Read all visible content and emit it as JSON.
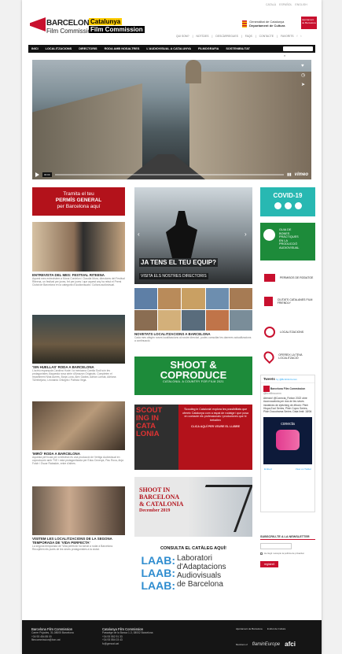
{
  "lang": [
    "CATALÀ",
    "ESPAÑOL",
    "ENGLISH"
  ],
  "logo": {
    "line1": "BARCELONA",
    "line2": "Film Commission",
    "cat": "Catalunya",
    "fc": "Film Commission"
  },
  "gencat": {
    "line1": "Generalitat de Catalunya",
    "line2": "Departament de Cultura"
  },
  "ajuntament": "Ajuntament de Barcelona",
  "topnav": [
    "QUI SOM?",
    "NOTÍCIES",
    "DESCÀRREGUES",
    "FAQS",
    "CONTACTE",
    "FAVORITS"
  ],
  "mainnav": [
    "INICI",
    "LOCALITZACIONS",
    "DIRECTORIS",
    "RODA AMB NOSALTRES",
    "L'AUDIOVISUAL A CATALUNYA",
    "FILMOGRAFIA",
    "SOSTENIBILITAT"
  ],
  "video": {
    "time": "00:00",
    "brand": "vimeo"
  },
  "col1": {
    "banner": [
      "Tramita el teu",
      "PERMÍS GENERAL",
      "per Barcelona aquí"
    ],
    "items": [
      {
        "title": "ENTREVISTA DEL MES: FESTIVAL RITEENA",
        "text": "Aquest mes entrevistem a Mona Cordelon i Claudia Mora, directores del Festival Riteena, un festival per joves, fet per joves i que aquest any ha rebut el Premi Ciutat de Barcelona en la categoria d'Audiovisuals i Cultura audiovisual."
      },
      {
        "title": "'SIN HUELLAS' RODA A BARCELONA",
        "text": "L'actriu espanyola Carolina Yuste i la mexicana Camila Sodi són les protagonistes d'aquesta nova sèrie d'Amazon Originals. Completen el repartiment Nina Aurres, Borja Luna, Alex Gadea, Adrian Lorista, Adriana Torrebejano, Leonardo Ortizgris i Patricia Vega."
      },
      {
        "title": "'MIRÓ' RODA A BARCELONA",
        "text": "Aquesta pel·lícula per a televisió és una producció de Vertigo Audiovisual en coproducció amb TVE i està protagonitzada per Eduu Doverya, Pau Roca, Anja Fotch i Óscar Rabadán, entre d'altres."
      },
      {
        "title": "VISITEM LES LOCALITZACIONS DE LA SEGONA TEMPORADA DE 'VIDA PERFECTA'",
        "text": "La segona temporada de 'Vida perfecta' ha tornat a rodar a Barcelona. Recopilem els punts de les seves protagonistes a la ciutat."
      }
    ]
  },
  "col2": {
    "slide_title": "JA TENS EL TEU EQUIP?",
    "slide_sub": "VISITA ELS NOSTRES DIRECTORIS",
    "news_title": "NOVETATS LOCALITZACIONS A BARCELONA",
    "news_text": "Cada mes afegim noves localitzacions al nostre directori, podeu consultar les darreres actualitzacions a continuació.",
    "shoot_a": "SHOOT &",
    "shoot_b": "COPRODUCE",
    "shoot_c": "CATALONIA. A COUNTRY FOR FILM 2021",
    "scout": [
      "SCOUT",
      "ING IN",
      "CATA",
      "LONIA"
    ],
    "scout_text": "'Scouting in Catalonia' explora les possibilitats que ofereix Catalunya com a espai de rodatge i que posa en contacte els professionals i productores que hi treballen",
    "scout_cta": "CLICA AQUÍ PER VEURE EL LLIBRE",
    "shoot_bcn": [
      "SHOOT IN",
      "BARCELONA",
      "& CATALONIA",
      "December 2019"
    ],
    "laab_title": "CONSULTA EL CATÀLEG AQUÍ!",
    "laab": [
      "Laboratori",
      "d'Adaptacions",
      "Audiovisuals",
      "de Barcelona"
    ]
  },
  "col3": {
    "covid": "COVID-19",
    "guide": [
      "GUIA DE",
      "BONES",
      "PRÀCTIQUES",
      "EN LA",
      "PRODUCCIÓ",
      "AUDIOVISUAL"
    ],
    "links": [
      "PERMISOS DE RODATGE",
      "CIUTATS CATALANES FILM FRIENDLY",
      "LOCALITZACIONS",
      "OFEREIX LA TEVA LOCALITZACIÓ"
    ],
    "tweets_label": "Tweets",
    "tweets_by": "by @BcnFilmComm",
    "tw_account": "Barcelona Film Commission",
    "tw_handle": "@bcnfilmcomm",
    "tw_text": "Atenció! @Conecta_Fiction 2022 obre #convocatòria per dos de les seves iniciatives de #pitching de #ficció: Pitch Hispa-Ecol Series, Pitch Copro Series, Pitch Docudrama Series. Data límit: 18/04",
    "embed": "Embed",
    "view": "View on Twitter",
    "conecta": "conecta",
    "newsletter": "SUBSCRIU-TE A LA NEWSLETTER",
    "newsletter_check": "He llegit i accepto la política de privacitat",
    "register": "registra't"
  },
  "footer": {
    "c1": [
      "Barcelona Film Commission",
      "Carrer Pujades, 31-08005 Barcelona",
      "+34 93 454 85 00",
      "filmcommission@bcn.cat"
    ],
    "c2": [
      "Catalunya Film Commission",
      "Passatge de la Banca 1-3, 08002 Barcelona",
      "+34 93 552 91 33",
      "+34 93 554 03 43",
      "fc@gencat.cat"
    ],
    "logos": [
      "Ajuntament de Barcelona",
      "Institut de Cultura",
      "Members of",
      "flaminEurope",
      "afci"
    ]
  },
  "colors": {
    "red": "#c8102e",
    "green": "#1d8b3a",
    "teal": "#28b8b2",
    "nav": "#111111"
  }
}
